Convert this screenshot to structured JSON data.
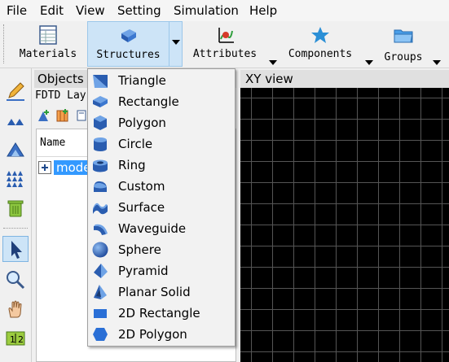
{
  "menubar": {
    "items": [
      {
        "label": "File"
      },
      {
        "label": "Edit"
      },
      {
        "label": "View"
      },
      {
        "label": "Setting"
      },
      {
        "label": "Simulation"
      },
      {
        "label": "Help"
      }
    ]
  },
  "toolbar": {
    "materials": "Materials",
    "structures": "Structures",
    "attributes": "Attributes",
    "components": "Components",
    "groups": "Groups"
  },
  "objects_panel": {
    "title": "Objects",
    "subtitle": "FDTD Lay",
    "column_name": "Name",
    "row_name": "mode"
  },
  "xy_view": {
    "title": "XY view"
  },
  "structures_menu": {
    "items": [
      {
        "label": "Triangle",
        "icon": "triangle-icon"
      },
      {
        "label": "Rectangle",
        "icon": "rectangle-icon"
      },
      {
        "label": "Polygon",
        "icon": "polygon-icon"
      },
      {
        "label": "Circle",
        "icon": "circle-icon"
      },
      {
        "label": "Ring",
        "icon": "ring-icon"
      },
      {
        "label": "Custom",
        "icon": "custom-icon"
      },
      {
        "label": "Surface",
        "icon": "surface-icon"
      },
      {
        "label": "Waveguide",
        "icon": "waveguide-icon"
      },
      {
        "label": "Sphere",
        "icon": "sphere-icon"
      },
      {
        "label": "Pyramid",
        "icon": "pyramid-icon"
      },
      {
        "label": "Planar Solid",
        "icon": "planar-solid-icon"
      },
      {
        "label": "2D Rectangle",
        "icon": "2d-rectangle-icon"
      },
      {
        "label": "2D Polygon",
        "icon": "2d-polygon-icon"
      }
    ]
  },
  "colors": {
    "accent_blue": "#3a6fc4",
    "selection": "#3399ff",
    "toolbar_selected": "#cde4f7",
    "canvas": "#000000",
    "grid": "#555555"
  }
}
